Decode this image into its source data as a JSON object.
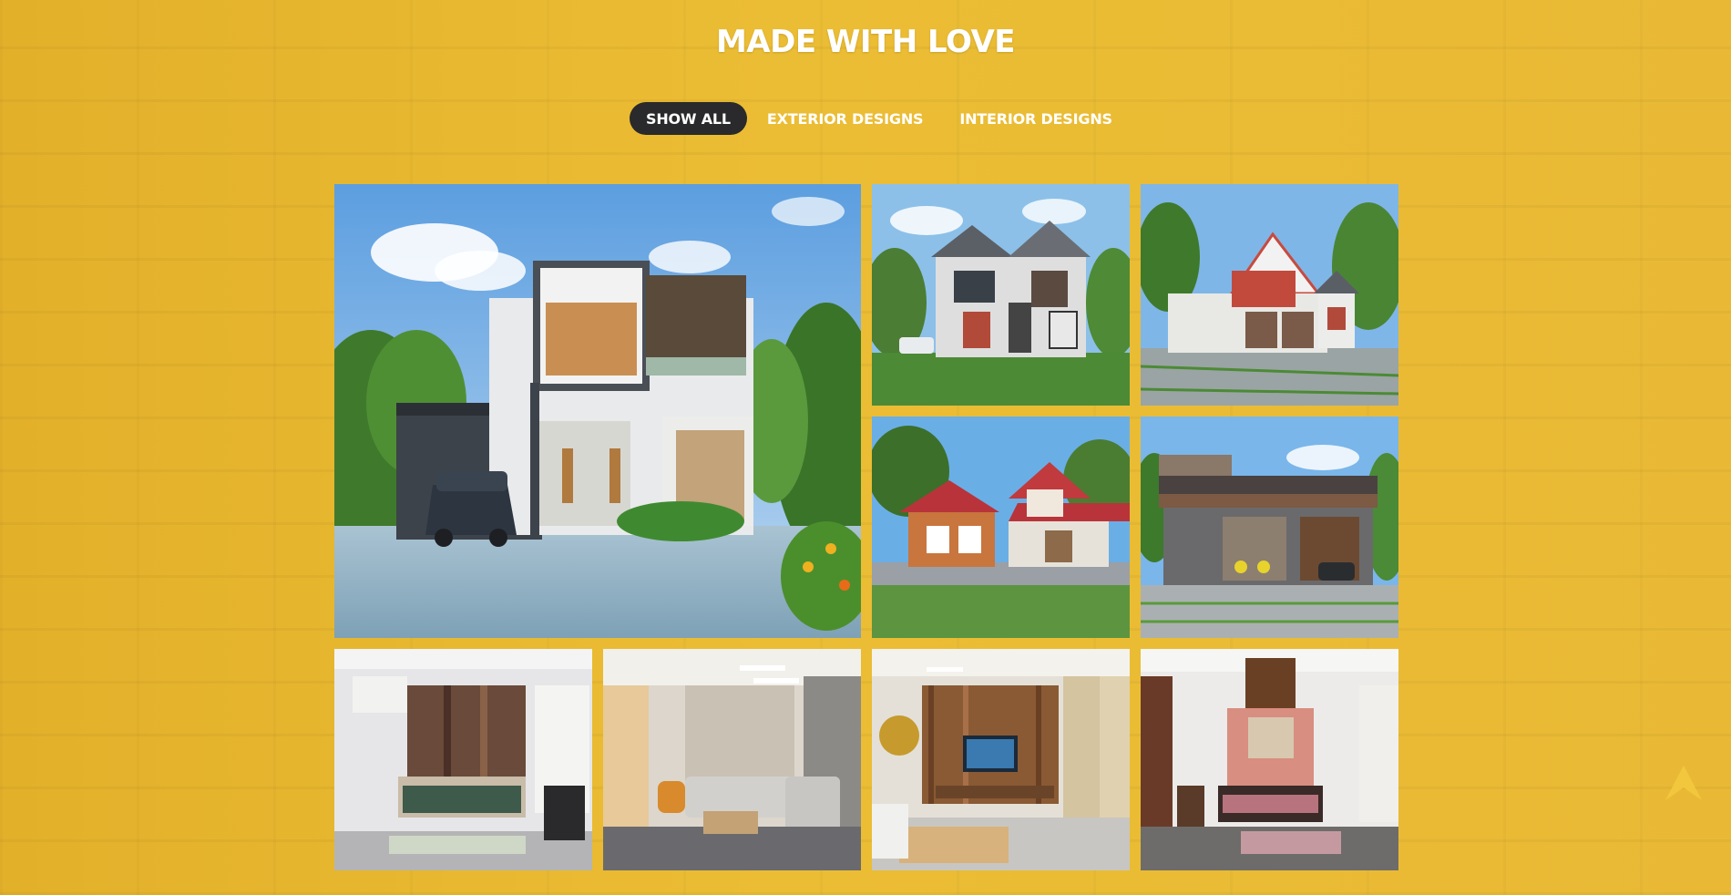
{
  "heading": "MADE WITH LOVE",
  "filters": [
    {
      "label": "SHOW ALL",
      "active": true
    },
    {
      "label": "EXTERIOR DESIGNS",
      "active": false
    },
    {
      "label": "INTERIOR DESIGNS",
      "active": false
    }
  ],
  "gallery": {
    "items": [
      {
        "category": "exterior",
        "subject": "modern two-storey house with car porch"
      },
      {
        "category": "exterior",
        "subject": "gabled two-storey house with parked car"
      },
      {
        "category": "exterior",
        "subject": "house with red accent gable and paved yard"
      },
      {
        "category": "exterior",
        "subject": "house with red tiled roof and lawn"
      },
      {
        "category": "exterior",
        "subject": "single-storey flat roof house with carport"
      },
      {
        "category": "interior",
        "subject": "bedroom with wooden panel wall"
      },
      {
        "category": "interior",
        "subject": "living room with L-shaped sofa"
      },
      {
        "category": "interior",
        "subject": "living room with TV unit"
      },
      {
        "category": "interior",
        "subject": "bedroom with brick accent wall"
      }
    ]
  },
  "colors": {
    "background": "#e8b830",
    "active_filter": "#2a2a2c",
    "text": "#ffffff",
    "scroll_icon": "#f3c93f"
  },
  "icons": {
    "scroll_to_top": "chevron-up-icon"
  }
}
